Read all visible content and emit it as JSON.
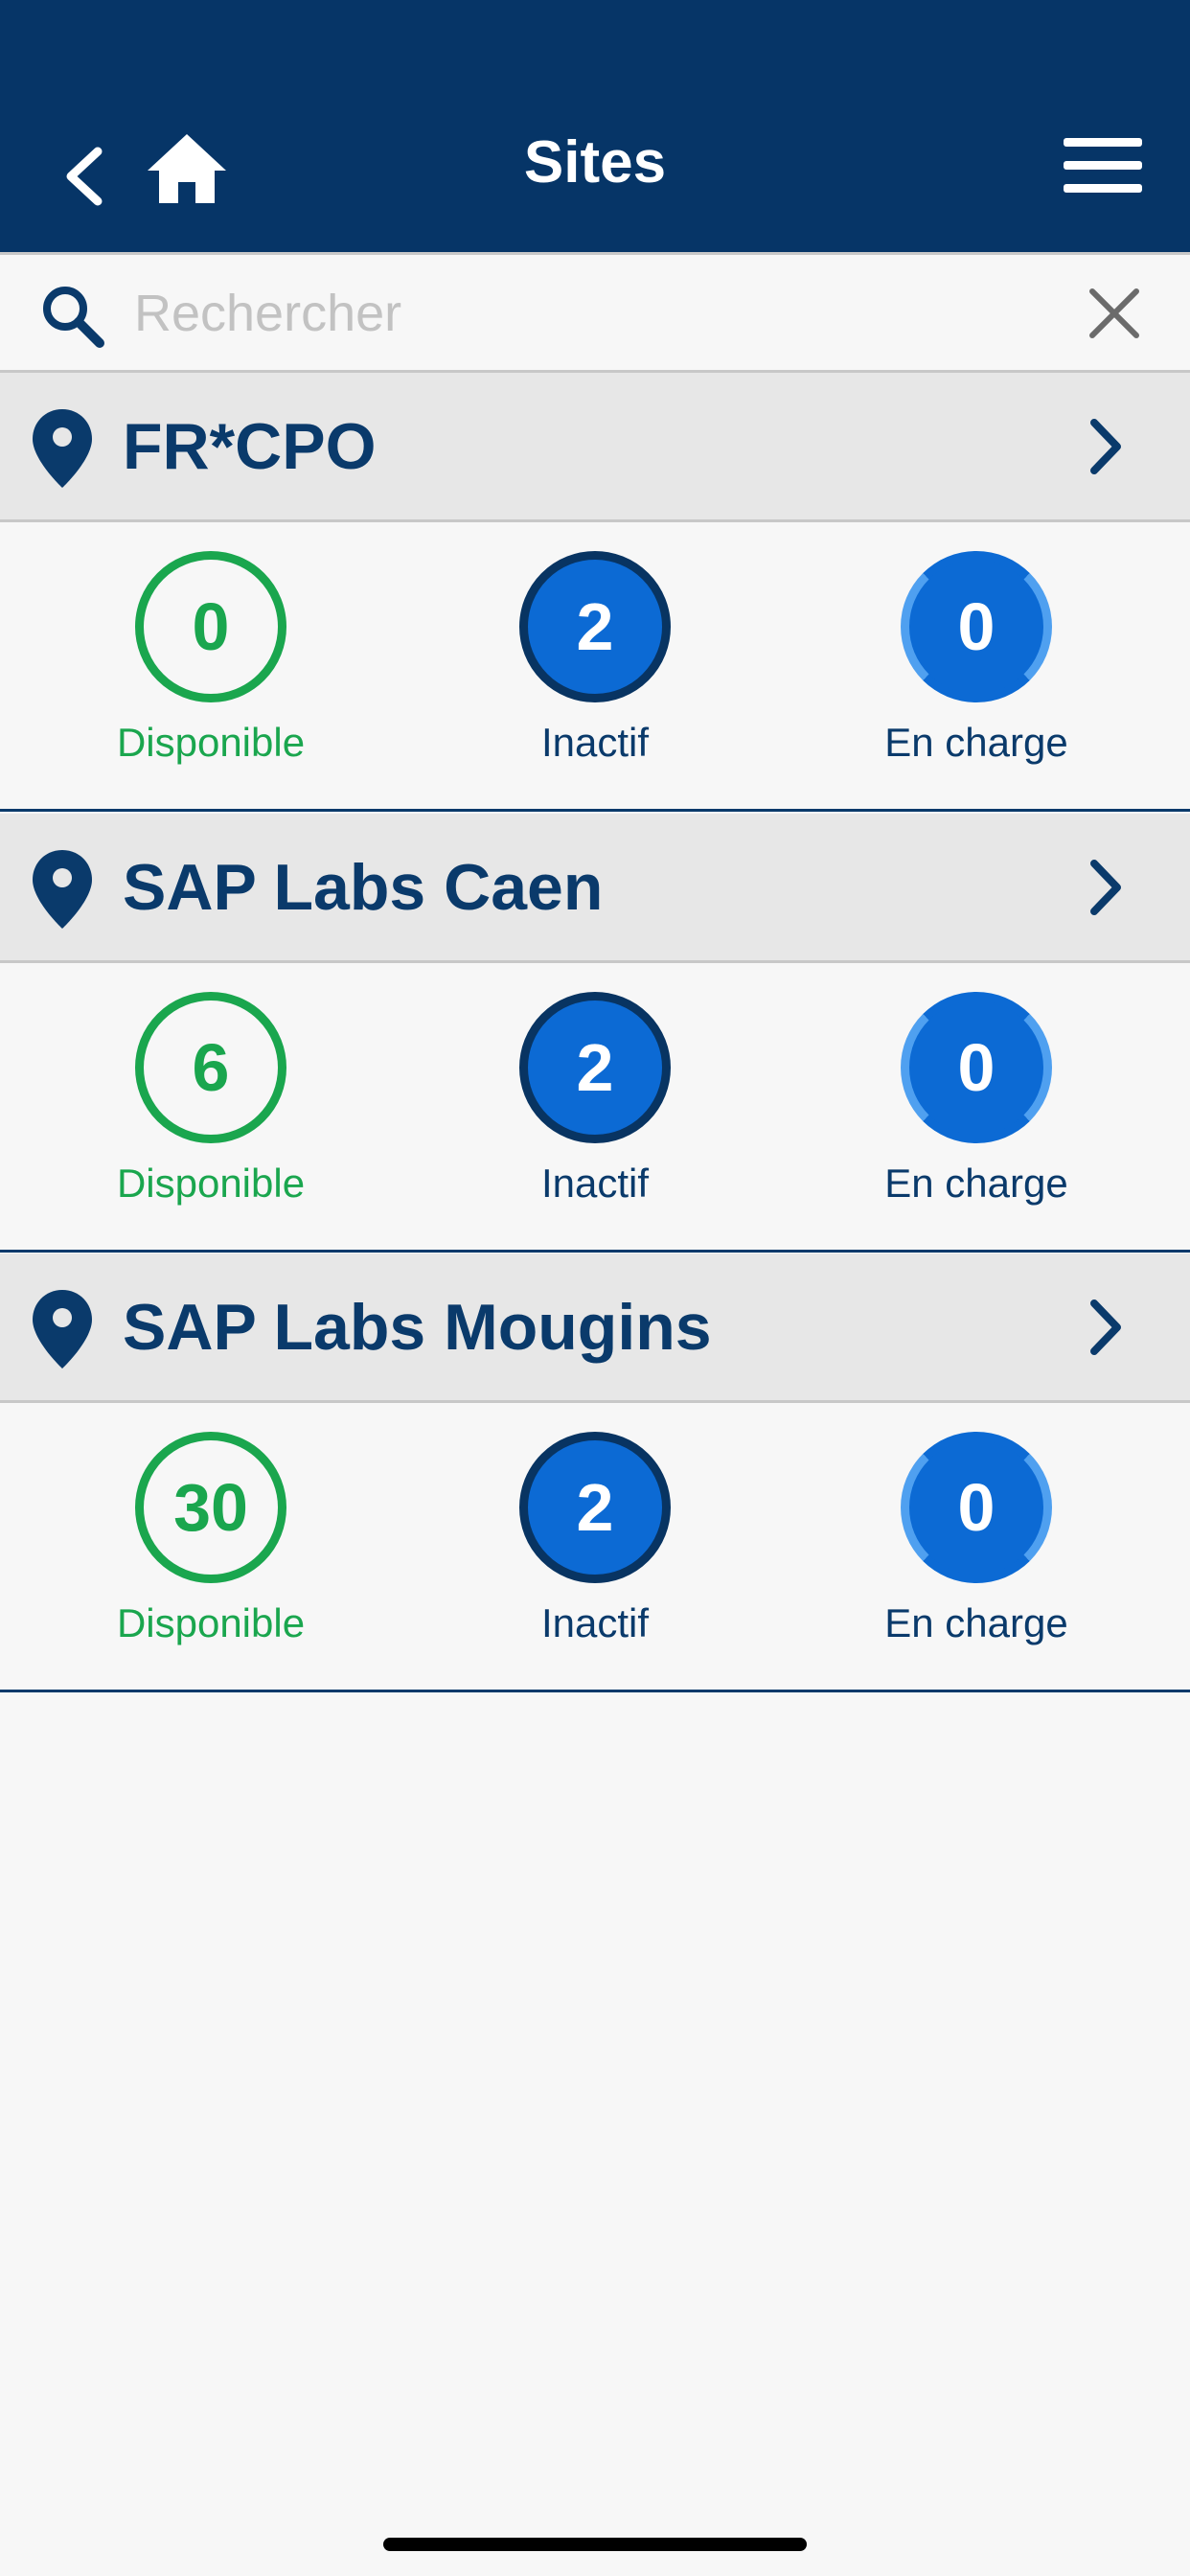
{
  "header": {
    "title": "Sites",
    "background_color": "#063567",
    "icons": [
      "chevron-left-icon",
      "home-icon",
      "hamburger-menu-icon"
    ]
  },
  "search": {
    "placeholder": "Rechercher",
    "value": ""
  },
  "sites": [
    {
      "name": "FR*CPO",
      "stats": {
        "disponible": {
          "value": "0",
          "label": "Disponible"
        },
        "inactif": {
          "value": "2",
          "label": "Inactif"
        },
        "en_charge": {
          "value": "0",
          "label": "En charge"
        }
      }
    },
    {
      "name": "SAP Labs Caen",
      "stats": {
        "disponible": {
          "value": "6",
          "label": "Disponible"
        },
        "inactif": {
          "value": "2",
          "label": "Inactif"
        },
        "en_charge": {
          "value": "0",
          "label": "En charge"
        }
      }
    },
    {
      "name": "SAP Labs Mougins",
      "stats": {
        "disponible": {
          "value": "30",
          "label": "Disponible"
        },
        "inactif": {
          "value": "2",
          "label": "Inactif"
        },
        "en_charge": {
          "value": "0",
          "label": "En charge"
        }
      }
    }
  ],
  "colors": {
    "primary": "#0a3a6b",
    "available": "#1aa64e",
    "inactive_bg": "#0c6ad4",
    "charging_ring": "#4fa0f0"
  }
}
